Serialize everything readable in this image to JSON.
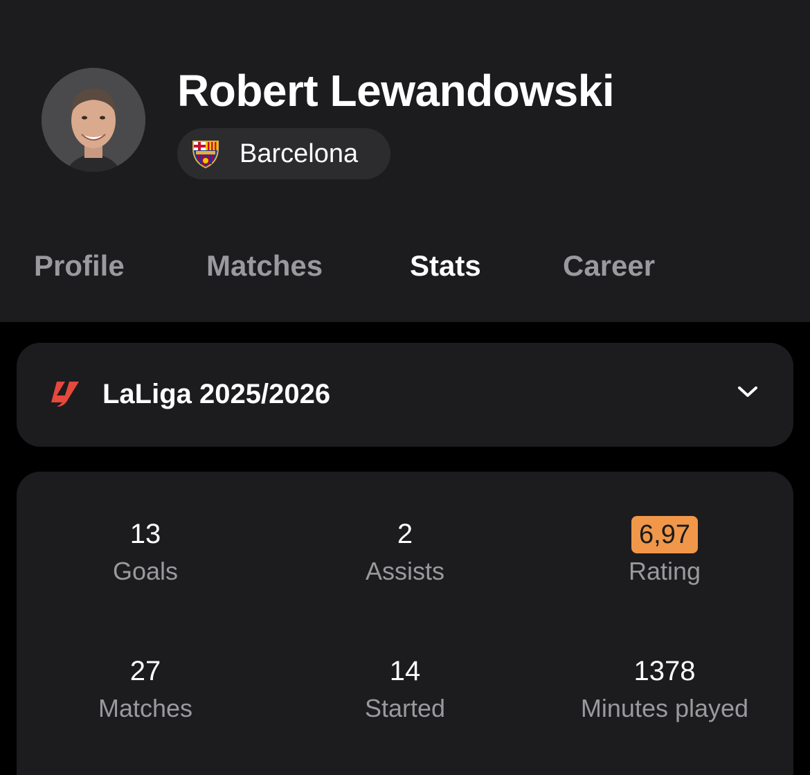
{
  "player": {
    "name": "Robert Lewandowski",
    "team": "Barcelona"
  },
  "tabs": [
    {
      "label": "Profile",
      "active": false
    },
    {
      "label": "Matches",
      "active": false
    },
    {
      "label": "Stats",
      "active": true
    },
    {
      "label": "Career",
      "active": false
    }
  ],
  "league_selector": {
    "label": "LaLiga 2025/2026",
    "icon": "laliga-logo-icon",
    "dropdown_icon": "chevron-down-icon"
  },
  "stats": [
    {
      "value": "13",
      "label": "Goals"
    },
    {
      "value": "2",
      "label": "Assists"
    },
    {
      "value": "6,97",
      "label": "Rating"
    },
    {
      "value": "27",
      "label": "Matches"
    },
    {
      "value": "14",
      "label": "Started"
    },
    {
      "value": "1378",
      "label": "Minutes played"
    }
  ],
  "colors": {
    "background": "#000000",
    "card": "#1c1c1e",
    "chip": "#2c2c2e",
    "muted_text": "#9a9a9e",
    "rating_badge": "#f0974a",
    "laliga_red": "#e5483c"
  }
}
